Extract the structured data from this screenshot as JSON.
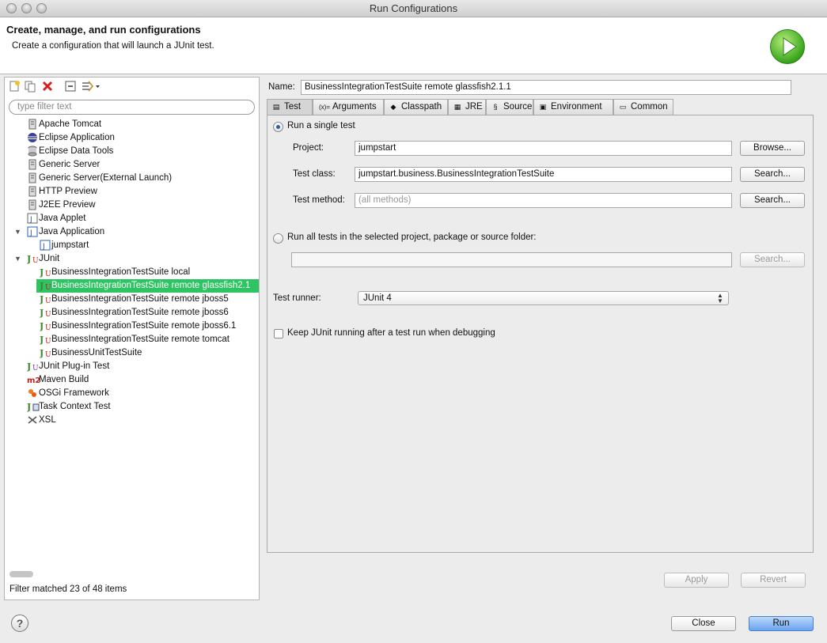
{
  "window": {
    "title": "Run Configurations"
  },
  "header": {
    "title": "Create, manage, and run configurations",
    "subtitle": "Create a configuration that will launch a JUnit test."
  },
  "left": {
    "filter_placeholder": "type filter text",
    "status": "Filter matched 23 of 48 items",
    "tree": [
      {
        "label": "Apache Tomcat",
        "icon": "server-icon",
        "level": 0
      },
      {
        "label": "Eclipse Application",
        "icon": "eclipse-icon",
        "level": 0
      },
      {
        "label": "Eclipse Data Tools",
        "icon": "database-icon",
        "level": 0
      },
      {
        "label": "Generic Server",
        "icon": "server-icon",
        "level": 0
      },
      {
        "label": "Generic Server(External Launch)",
        "icon": "server-icon",
        "level": 0
      },
      {
        "label": "HTTP Preview",
        "icon": "server-icon",
        "level": 0
      },
      {
        "label": "J2EE Preview",
        "icon": "server-icon",
        "level": 0
      },
      {
        "label": "Java Applet",
        "icon": "java-applet-icon",
        "level": 0
      },
      {
        "label": "Java Application",
        "icon": "java-app-icon",
        "level": 0,
        "expanded": true
      },
      {
        "label": "jumpstart",
        "icon": "java-app-icon",
        "level": 1
      },
      {
        "label": "JUnit",
        "icon": "junit-icon",
        "level": 0,
        "expanded": true
      },
      {
        "label": "BusinessIntegrationTestSuite local",
        "icon": "junit-icon",
        "level": 1
      },
      {
        "label": "BusinessIntegrationTestSuite remote glassfish2.1",
        "icon": "junit-icon",
        "level": 1,
        "selected": true
      },
      {
        "label": "BusinessIntegrationTestSuite remote jboss5",
        "icon": "junit-icon",
        "level": 1
      },
      {
        "label": "BusinessIntegrationTestSuite remote jboss6",
        "icon": "junit-icon",
        "level": 1
      },
      {
        "label": "BusinessIntegrationTestSuite remote jboss6.1",
        "icon": "junit-icon",
        "level": 1
      },
      {
        "label": "BusinessIntegrationTestSuite remote tomcat",
        "icon": "junit-icon",
        "level": 1
      },
      {
        "label": "BusinessUnitTestSuite",
        "icon": "junit-icon",
        "level": 1
      },
      {
        "label": "JUnit Plug-in Test",
        "icon": "junit-plugin-icon",
        "level": 0
      },
      {
        "label": "Maven Build",
        "icon": "maven-icon",
        "level": 0
      },
      {
        "label": "OSGi Framework",
        "icon": "osgi-icon",
        "level": 0
      },
      {
        "label": "Task Context Test",
        "icon": "task-context-icon",
        "level": 0
      },
      {
        "label": "XSL",
        "icon": "xsl-icon",
        "level": 0
      }
    ]
  },
  "config": {
    "name_label": "Name:",
    "name_value": "BusinessIntegrationTestSuite remote glassfish2.1.1",
    "tabs": [
      {
        "label": "Test",
        "icon": "test-tab-icon",
        "active": true
      },
      {
        "label": "Arguments",
        "icon": "arguments-icon"
      },
      {
        "label": "Classpath",
        "icon": "classpath-icon"
      },
      {
        "label": "JRE",
        "icon": "jre-icon"
      },
      {
        "label": "Source",
        "icon": "source-icon"
      },
      {
        "label": "Environment",
        "icon": "environment-icon"
      },
      {
        "label": "Common",
        "icon": "common-icon"
      }
    ],
    "test": {
      "run_single_label": "Run a single test",
      "project_label": "Project:",
      "project_value": "jumpstart",
      "browse_label": "Browse...",
      "test_class_label": "Test class:",
      "test_class_value": "jumpstart.business.BusinessIntegrationTestSuite",
      "search_label": "Search...",
      "test_method_label": "Test method:",
      "test_method_placeholder": "(all methods)",
      "run_all_label": "Run all tests in the selected project, package or source folder:",
      "test_runner_label": "Test runner:",
      "test_runner_value": "JUnit 4",
      "keep_running_label": "Keep JUnit running after a test run when debugging"
    }
  },
  "buttons": {
    "apply": "Apply",
    "revert": "Revert",
    "close": "Close",
    "run": "Run",
    "help": "?"
  }
}
